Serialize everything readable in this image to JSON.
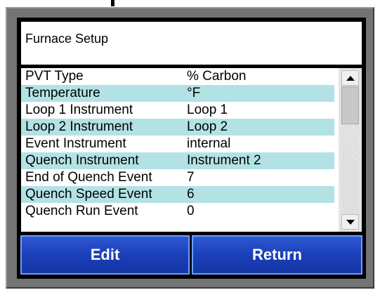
{
  "title": "Furnace Setup",
  "rows": [
    {
      "label": "PVT Type",
      "value": "% Carbon"
    },
    {
      "label": "Temperature",
      "value": "°F"
    },
    {
      "label": "Loop 1 Instrument",
      "value": "Loop 1"
    },
    {
      "label": "Loop 2 Instrument",
      "value": "Loop 2"
    },
    {
      "label": "Event Instrument",
      "value": "internal"
    },
    {
      "label": "Quench Instrument",
      "value": "Instrument 2"
    },
    {
      "label": "End of Quench Event",
      "value": "7"
    },
    {
      "label": "Quench Speed Event",
      "value": "6"
    },
    {
      "label": "Quench Run Event",
      "value": "0"
    }
  ],
  "buttons": {
    "edit": "Edit",
    "return": "Return"
  },
  "colors": {
    "row_highlight": "#b3e2e4",
    "button": "#1b3fb8",
    "button_border": "#6aa0ff",
    "bezel": "#747474"
  }
}
